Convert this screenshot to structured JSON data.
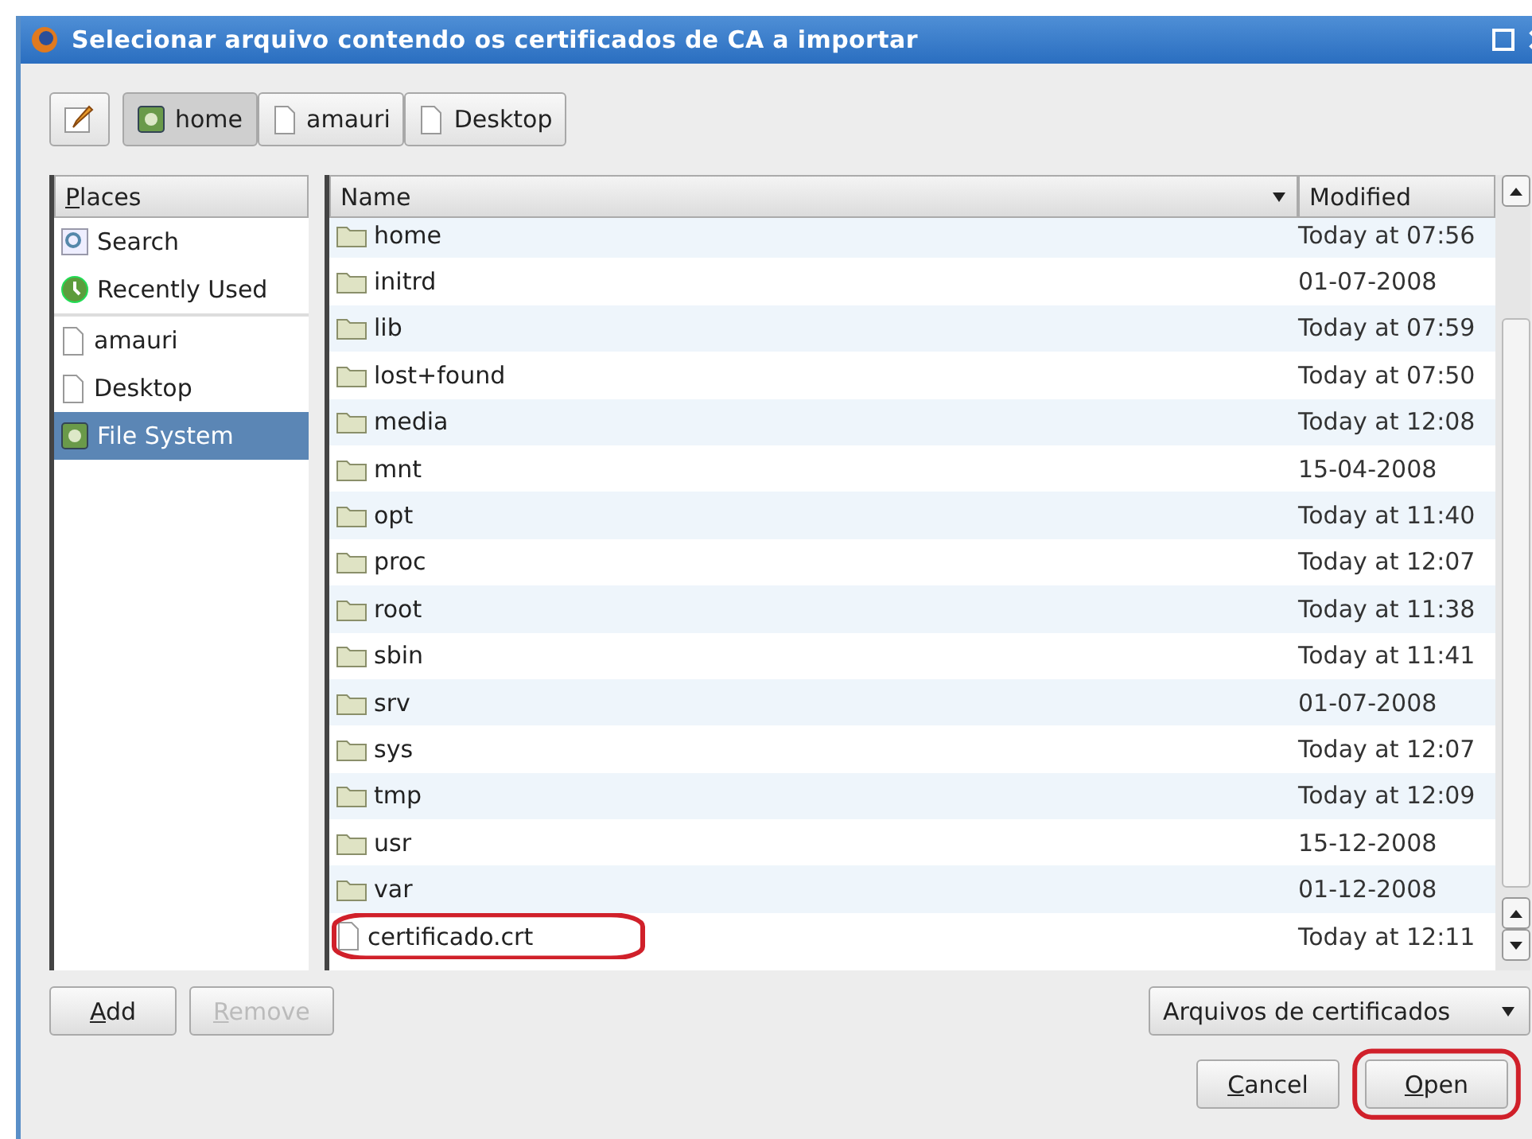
{
  "window": {
    "title": "Selecionar arquivo contendo os certificados de CA a importar"
  },
  "path_bar": {
    "buttons": [
      {
        "label": "home",
        "kind": "drive",
        "selected": true
      },
      {
        "label": "amauri",
        "kind": "folder",
        "selected": false
      },
      {
        "label": "Desktop",
        "kind": "folder",
        "selected": false
      }
    ]
  },
  "places": {
    "heading": "Places",
    "items": [
      {
        "label": "Search",
        "kind": "search",
        "selected": false
      },
      {
        "label": "Recently Used",
        "kind": "recent",
        "selected": false
      },
      {
        "label": "amauri",
        "kind": "folder",
        "selected": false
      },
      {
        "label": "Desktop",
        "kind": "folder",
        "selected": false
      },
      {
        "label": "File System",
        "kind": "drive",
        "selected": true
      }
    ]
  },
  "files": {
    "columns": [
      "Name",
      "Modified"
    ],
    "rows": [
      {
        "name": "home",
        "modified": "Today at 07:56",
        "kind": "folder",
        "highlighted": false
      },
      {
        "name": "initrd",
        "modified": "01-07-2008",
        "kind": "folder",
        "highlighted": false
      },
      {
        "name": "lib",
        "modified": "Today at 07:59",
        "kind": "folder",
        "highlighted": false
      },
      {
        "name": "lost+found",
        "modified": "Today at 07:50",
        "kind": "folder",
        "highlighted": false
      },
      {
        "name": "media",
        "modified": "Today at 12:08",
        "kind": "folder",
        "highlighted": false
      },
      {
        "name": "mnt",
        "modified": "15-04-2008",
        "kind": "folder",
        "highlighted": false
      },
      {
        "name": "opt",
        "modified": "Today at 11:40",
        "kind": "folder",
        "highlighted": false
      },
      {
        "name": "proc",
        "modified": "Today at 12:07",
        "kind": "folder",
        "highlighted": false
      },
      {
        "name": "root",
        "modified": "Today at 11:38",
        "kind": "folder",
        "highlighted": false
      },
      {
        "name": "sbin",
        "modified": "Today at 11:41",
        "kind": "folder",
        "highlighted": false
      },
      {
        "name": "srv",
        "modified": "01-07-2008",
        "kind": "folder",
        "highlighted": false
      },
      {
        "name": "sys",
        "modified": "Today at 12:07",
        "kind": "folder",
        "highlighted": false
      },
      {
        "name": "tmp",
        "modified": "Today at 12:09",
        "kind": "folder",
        "highlighted": false
      },
      {
        "name": "usr",
        "modified": "15-12-2008",
        "kind": "folder",
        "highlighted": false
      },
      {
        "name": "var",
        "modified": "01-12-2008",
        "kind": "folder",
        "highlighted": false
      },
      {
        "name": "certificado.crt",
        "modified": "Today at 12:11",
        "kind": "file",
        "highlighted": true
      }
    ]
  },
  "place_buttons": [
    {
      "label": "Add",
      "disabled": false
    },
    {
      "label": "Remove",
      "disabled": true
    }
  ],
  "filter": {
    "value": "Arquivos de certificados"
  },
  "buttons": [
    {
      "label": "Cancel",
      "highlighted": false
    },
    {
      "label": "Open",
      "highlighted": true
    }
  ]
}
